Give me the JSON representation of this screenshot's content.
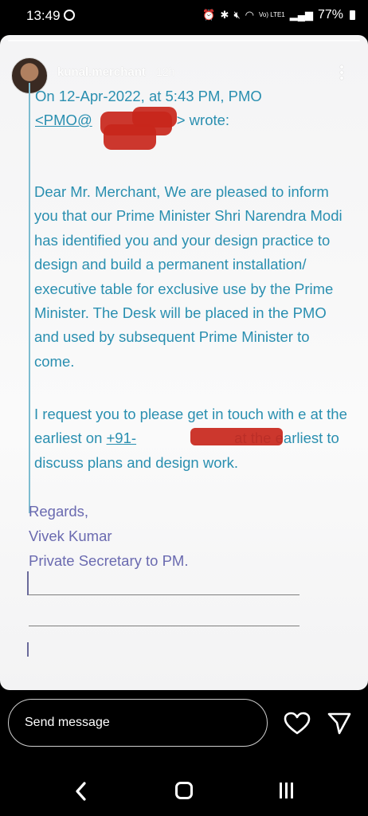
{
  "status_bar": {
    "time": "13:49",
    "battery": "77%",
    "network": "Vo) LTE1"
  },
  "story": {
    "username": "kunal.merchant",
    "time_ago": "12h",
    "email": {
      "header_line1": "On 12-Apr-2022, at 5:43 PM, PMO",
      "header_line2_start": "<PMO@",
      "header_line2_end": "> wrote:",
      "paragraph1": "Dear Mr. Merchant, We are pleased to inform you that our Prime Minister Shri Narendra Modi has identified you and your design practice to design and build a permanent installation/ executive table for exclusive use by the Prime Minister. The Desk will be placed in the PMO and used by subsequent Prime Minister to come.",
      "paragraph2_start": "I request you to please get in touch with e at the earliest on ",
      "phone_prefix": "+91-",
      "paragraph2_end": " at the earliest to discuss plans and design work.",
      "regards": "Regards,",
      "signer_name": "Vivek Kumar",
      "signer_title": "Private Secretary to PM."
    }
  },
  "bottom": {
    "message_placeholder": "Send message"
  },
  "colors": {
    "email_blue": "#2a8fb0",
    "signature_purple": "#6a6ab0",
    "redaction_red": "#c8261b"
  }
}
